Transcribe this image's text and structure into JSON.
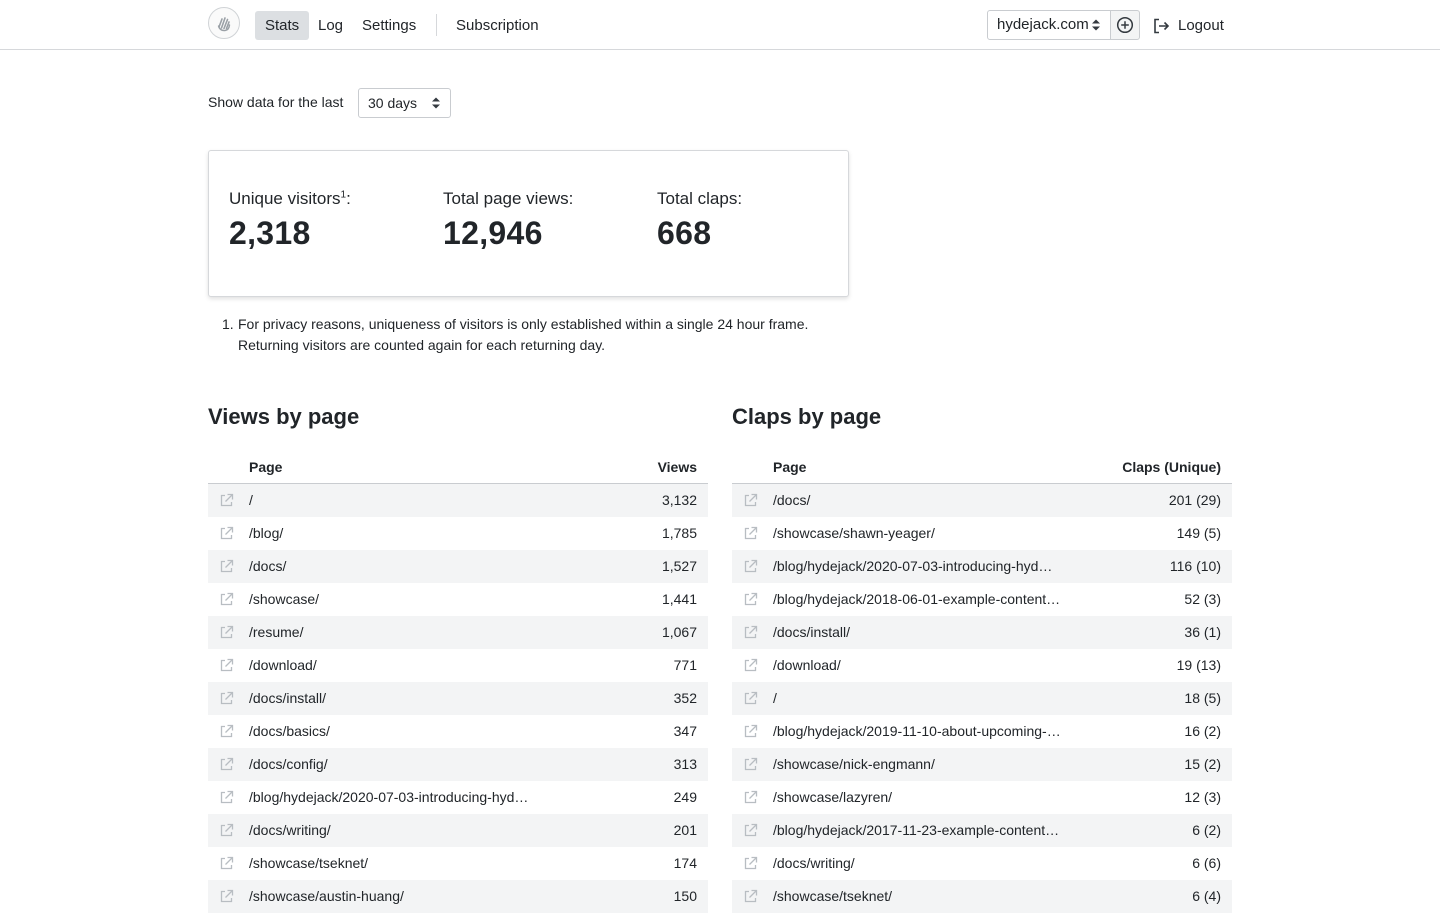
{
  "nav": {
    "items": [
      {
        "label": "Stats",
        "active": true
      },
      {
        "label": "Log",
        "active": false
      },
      {
        "label": "Settings",
        "active": false
      },
      {
        "label": "Subscription",
        "active": false
      }
    ],
    "site": "hydejack.com",
    "logout": "Logout"
  },
  "range": {
    "label": "Show data for the last",
    "value": "30 days"
  },
  "summary": {
    "visitors_label": "Unique visitors",
    "visitors_sup": "1",
    "visitors_colon": ":",
    "visitors_value": "2,318",
    "views_label": "Total page views:",
    "views_value": "12,946",
    "claps_label": "Total claps:",
    "claps_value": "668"
  },
  "footnote": {
    "num": "1.",
    "line1": "For privacy reasons, uniqueness of visitors is only established within a single 24 hour frame.",
    "line2": "Returning visitors are counted again for each returning day."
  },
  "views": {
    "title": "Views by page",
    "col_page": "Page",
    "col_value": "Views",
    "rows": [
      {
        "page": "/",
        "value": "3,132"
      },
      {
        "page": "/blog/",
        "value": "1,785"
      },
      {
        "page": "/docs/",
        "value": "1,527"
      },
      {
        "page": "/showcase/",
        "value": "1,441"
      },
      {
        "page": "/resume/",
        "value": "1,067"
      },
      {
        "page": "/download/",
        "value": "771"
      },
      {
        "page": "/docs/install/",
        "value": "352"
      },
      {
        "page": "/docs/basics/",
        "value": "347"
      },
      {
        "page": "/docs/config/",
        "value": "313"
      },
      {
        "page": "/blog/hydejack/2020-07-03-introducing-hyd…",
        "value": "249"
      },
      {
        "page": "/docs/writing/",
        "value": "201"
      },
      {
        "page": "/showcase/tseknet/",
        "value": "174"
      },
      {
        "page": "/showcase/austin-huang/",
        "value": "150"
      }
    ]
  },
  "claps": {
    "title": "Claps by page",
    "col_page": "Page",
    "col_value": "Claps (Unique)",
    "rows": [
      {
        "page": "/docs/",
        "value": "201 (29)"
      },
      {
        "page": "/showcase/shawn-yeager/",
        "value": "149 (5)"
      },
      {
        "page": "/blog/hydejack/2020-07-03-introducing-hyd…",
        "value": "116 (10)"
      },
      {
        "page": "/blog/hydejack/2018-06-01-example-content…",
        "value": "52 (3)"
      },
      {
        "page": "/docs/install/",
        "value": "36 (1)"
      },
      {
        "page": "/download/",
        "value": "19 (13)"
      },
      {
        "page": "/",
        "value": "18 (5)"
      },
      {
        "page": "/blog/hydejack/2019-11-10-about-upcoming-…",
        "value": "16 (2)"
      },
      {
        "page": "/showcase/nick-engmann/",
        "value": "15 (2)"
      },
      {
        "page": "/showcase/lazyren/",
        "value": "12 (3)"
      },
      {
        "page": "/blog/hydejack/2017-11-23-example-content…",
        "value": "6 (2)"
      },
      {
        "page": "/docs/writing/",
        "value": "6 (6)"
      },
      {
        "page": "/showcase/tseknet/",
        "value": "6 (4)"
      }
    ]
  }
}
